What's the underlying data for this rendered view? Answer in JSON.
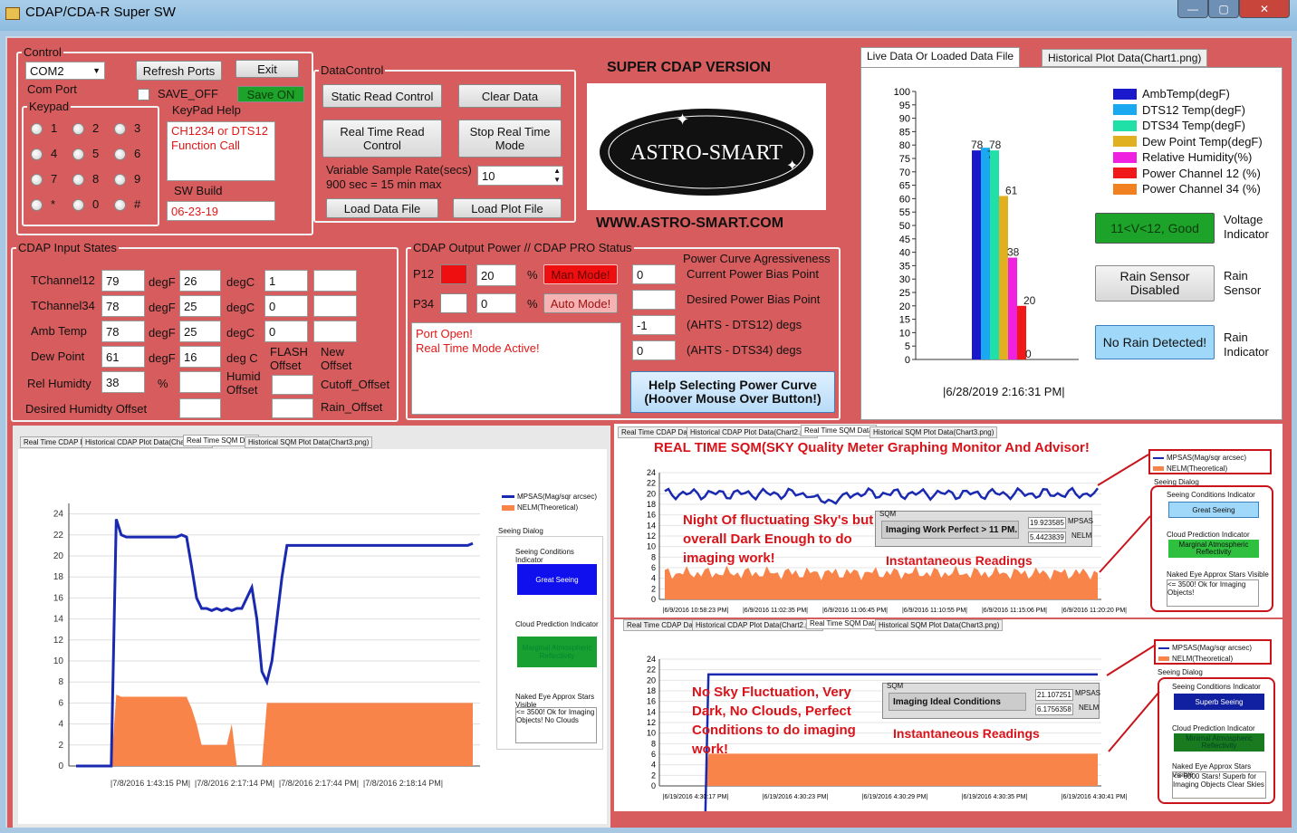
{
  "window": {
    "title": "CDAP/CDA-R Super SW",
    "minimize": "—",
    "maximize": "▢",
    "close": "✕"
  },
  "control": {
    "legend": "Control",
    "com_port_value": "COM2",
    "com_port_label": "Com Port",
    "refresh_ports": "Refresh Ports",
    "exit": "Exit",
    "save_off": "SAVE_OFF",
    "save_on": "Save ON",
    "keypad_legend": "Keypad",
    "keypad_keys": [
      "1",
      "2",
      "3",
      "4",
      "5",
      "6",
      "7",
      "8",
      "9",
      "*",
      "0",
      "#"
    ],
    "keypad_help_label": "KeyPad Help",
    "keypad_help_text": "CH1234 or DTS12 Function Call",
    "sw_build_label": "SW Build",
    "sw_build_value": "06-23-19"
  },
  "data_control": {
    "legend": "DataControl",
    "static_read": "Static Read Control",
    "clear_data": "Clear Data",
    "real_time_read": "Real Time Read Control",
    "stop_real_time": "Stop Real Time Mode",
    "sample_rate_label": "Variable Sample Rate(secs)",
    "sample_rate_hint": "900 sec = 15 min max",
    "sample_rate_value": "10",
    "load_data_file": "Load Data File",
    "load_plot_file": "Load Plot File"
  },
  "logo": {
    "heading": "SUPER CDAP VERSION",
    "brand": "ASTRO-SMART",
    "url": "WWW.ASTRO-SMART.COM"
  },
  "input_states": {
    "legend": "CDAP Input States",
    "rows": [
      {
        "label": "TChannel12",
        "f": "79",
        "f_unit": "degF",
        "c": "26",
        "c_unit": "degC",
        "extra": "1",
        "extra2": ""
      },
      {
        "label": "TChannel34",
        "f": "78",
        "f_unit": "degF",
        "c": "25",
        "c_unit": "degC",
        "extra": "0",
        "extra2": ""
      },
      {
        "label": "Amb Temp",
        "f": "78",
        "f_unit": "degF",
        "c": "25",
        "c_unit": "degC",
        "extra": "0",
        "extra2": ""
      },
      {
        "label": "Dew Point",
        "f": "61",
        "f_unit": "degF",
        "c": "16",
        "c_unit": "deg C"
      }
    ],
    "flash_offset": "FLASH Offset",
    "new_offset": "New Offset",
    "rel_humidity_label": "Rel Humidty",
    "rel_humidity_value": "38",
    "pct": "%",
    "humid_offset": "Humid Offset",
    "cutoff_offset": "Cutoff_Offset",
    "desired_humidity_offset": "Desired Humidty Offset",
    "rain_offset": "Rain_Offset"
  },
  "output_power": {
    "legend": "CDAP Output Power  //  CDAP PRO Status",
    "p12_label": "P12",
    "p12_value": "20",
    "p34_label": "P34",
    "p34_value": "0",
    "pct": "%",
    "man_mode": "Man Mode!",
    "auto_mode": "Auto Mode!",
    "status_lines": [
      "Port Open!",
      "Real Time Mode Active!"
    ],
    "power_curve_title": "Power Curve Agressiveness",
    "rows": [
      {
        "value": "0",
        "label": "Current Power Bias Point"
      },
      {
        "value": "",
        "label": "Desired Power Bias Point"
      },
      {
        "value": "-1",
        "label": "(AHTS - DTS12) degs"
      },
      {
        "value": "0",
        "label": "(AHTS - DTS34) degs"
      }
    ],
    "help_button": "Help Selecting Power Curve (Hoover Mouse Over Button!)"
  },
  "live_chart": {
    "tab_active": "Live Data Or Loaded Data File",
    "tab_inactive": "Historical Plot Data(Chart1.png)",
    "timestamp": "|6/28/2019 2:16:31 PM|",
    "voltage_value": "11<V<12, Good",
    "voltage_label": "Voltage Indicator",
    "rain_sensor_value": "Rain Sensor Disabled",
    "rain_sensor_label": "Rain Sensor",
    "rain_indicator_value": "No Rain Detected!",
    "rain_indicator_label": "Rain Indicator"
  },
  "chart_data": [
    {
      "type": "bar",
      "title": "",
      "ylim": [
        0,
        100
      ],
      "yticks": [
        0,
        5,
        10,
        15,
        20,
        25,
        30,
        35,
        40,
        45,
        50,
        55,
        60,
        65,
        70,
        75,
        80,
        85,
        90,
        95,
        100
      ],
      "series": [
        {
          "name": "AmbTemp(degF)",
          "value": 78,
          "label": "78",
          "color": "#1a1acc"
        },
        {
          "name": "DTS12 Temp(degF)",
          "value": 79,
          "label": "79",
          "color": "#1aa8f0"
        },
        {
          "name": "DTS34 Temp(degF)",
          "value": 78,
          "label": "78",
          "color": "#20e0a8"
        },
        {
          "name": "Dew Point Temp(degF)",
          "value": 61,
          "label": "61",
          "color": "#e0b020"
        },
        {
          "name": "Relative Humidity(%)",
          "value": 38,
          "label": "38",
          "color": "#f020e0"
        },
        {
          "name": "Power Channel 12 (%)",
          "value": 20,
          "label": "20",
          "color": "#f01818"
        },
        {
          "name": "Power Channel 34 (%)",
          "value": 0,
          "label": "0",
          "color": "#f08020"
        }
      ]
    },
    {
      "type": "area",
      "yticks": [
        0,
        2,
        4,
        6,
        8,
        10,
        12,
        14,
        16,
        18,
        20,
        22,
        24
      ],
      "ylim": [
        0,
        25
      ],
      "xticks": [
        "|7/8/2016 1:43:15 PM|",
        "|7/8/2016 2:17:14 PM|",
        "|7/8/2016 2:17:44 PM|",
        "|7/8/2016 2:18:14 PM|"
      ],
      "series": [
        {
          "name": "MPSAS(Mag/sqr arcsec)",
          "type": "line",
          "color": "#1a2ab0",
          "values": [
            0,
            0,
            0,
            0,
            0,
            0,
            0,
            0,
            23.5,
            22,
            21.8,
            21.8,
            21.8,
            21.8,
            21.8,
            21.8,
            21.8,
            21.8,
            21.8,
            21.8,
            21.8,
            22,
            21.8,
            19,
            16,
            15,
            15,
            14.8,
            15,
            14.8,
            15,
            14.8,
            15,
            15,
            16,
            17,
            14,
            9,
            8,
            10,
            14,
            18,
            21,
            21,
            21,
            21,
            21,
            21,
            21,
            21,
            21,
            21,
            21,
            21,
            21,
            21,
            21,
            21,
            21,
            21,
            21,
            21,
            21,
            21,
            21,
            21,
            21,
            21,
            21,
            21,
            21,
            21,
            21,
            21,
            21,
            21,
            21,
            21,
            21,
            21.2
          ]
        },
        {
          "name": "NELM(Theoretical)",
          "type": "area",
          "color": "#f8844a",
          "values": [
            0,
            0,
            0,
            0,
            0,
            0,
            0,
            0,
            6.8,
            6.6,
            6.6,
            6.6,
            6.6,
            6.6,
            6.6,
            6.6,
            6.6,
            6.6,
            6.6,
            6.6,
            6.6,
            6.6,
            6.6,
            5.5,
            4,
            2,
            2,
            2,
            2,
            2,
            2,
            4,
            0,
            0,
            0,
            0,
            0,
            0,
            6,
            6,
            6,
            6,
            6,
            6,
            6,
            6,
            6,
            6,
            6,
            6,
            6,
            6,
            6,
            6,
            6,
            6,
            6,
            6,
            6,
            6,
            6,
            6,
            6,
            6,
            6,
            6,
            6,
            6,
            6,
            6,
            6,
            6,
            6,
            6,
            6,
            6,
            6,
            6,
            6,
            6
          ]
        }
      ]
    }
  ],
  "sqm_main": {
    "tabs": [
      "Real Time CDAP Data",
      "Historical CDAP Plot Data(Chart2.png)",
      "Real Time SQM Data",
      "Historical SQM Plot Data(Chart3.png)"
    ],
    "legend_mpsas": "MPSAS(Mag/sqr arcsec)",
    "legend_nelm": "NELM(Theoretical)",
    "seeing_dialog": "Seeing Dialog",
    "seeing_conditions": "Seeing Conditions Indicator",
    "great_seeing": "Great Seeing",
    "cloud_prediction": "Cloud Prediction Indicator",
    "marginal": "Marginal Atmospheric Reflectivity",
    "naked_eye": "Naked Eye Approx Stars Visible",
    "naked_eye_text": "<= 3500! Ok for Imaging Objects! No Clouds"
  },
  "sqm_top": {
    "heading": "REAL TIME SQM(SKY Quality Meter Graphing Monitor And Advisor!",
    "annotation": "Night Of fluctuating Sky's but overall Dark Enough to do imaging work!",
    "inst": "Instantaneous Readings",
    "sqm_label": "SQM",
    "status": "Imaging Work Perfect > 11 PM.",
    "mpsas_value": "19.923585",
    "mpsas_unit": "MPSAS",
    "nelm_value": "5.4423839",
    "nelm_unit": "NELM",
    "yticks": [
      0,
      2,
      4,
      6,
      8,
      10,
      12,
      14,
      16,
      18,
      20,
      22,
      24
    ],
    "xticks": [
      "|6/9/2016 10:58:23 PM|",
      "|6/9/2016 11:02:35 PM|",
      "|6/9/2016 11:06:45 PM|",
      "|6/9/2016 11:10:55 PM|",
      "|6/9/2016 11:15:06 PM|",
      "|6/9/2016 11:20:20 PM|"
    ],
    "legend_mpsas": "MPSAS(Mag/sqr arcsec)",
    "legend_nelm": "NELM(Theoretical)",
    "seeing_dialog": "Seeing Dialog",
    "seeing_conditions": "Seeing Conditions Indicator",
    "seeing_value": "Great Seeing",
    "cloud_prediction": "Cloud Prediction Indicator",
    "cloud_value": "Marginal Atmospheric Reflectivity",
    "naked_eye": "Naked Eye Approx Stars Visible",
    "naked_eye_text": "<= 3500! Ok for Imaging Objects!"
  },
  "sqm_bottom": {
    "tabs": [
      "Real Time CDAP Data",
      "Historical CDAP Plot Data(Chart2.png)",
      "Real Time SQM Data",
      "Historical SQM Plot Data(Chart3.png)"
    ],
    "annotation": "No Sky Fluctuation, Very Dark, No Clouds, Perfect Conditions to do imaging work!",
    "inst": "Instantaneous Readings",
    "sqm_label": "SQM",
    "status": "Imaging Ideal Conditions",
    "mpsas_value": "21.107251",
    "mpsas_unit": "MPSAS",
    "nelm_value": "6.1756358",
    "nelm_unit": "NELM",
    "yticks": [
      0,
      2,
      4,
      6,
      8,
      10,
      12,
      14,
      16,
      18,
      20,
      22,
      24
    ],
    "xticks": [
      "|6/19/2016 4:30:17 PM|",
      "|6/19/2016 4:30:23 PM|",
      "|6/19/2016 4:30:29 PM|",
      "|6/19/2016 4:30:35 PM|",
      "|6/19/2016 4:30:41 PM|"
    ],
    "legend_mpsas": "MPSAS(Mag/sqr arcsec)",
    "legend_nelm": "NELM(Theoretical)",
    "seeing_dialog": "Seeing Dialog",
    "seeing_conditions": "Seeing Conditions Indicator",
    "seeing_value": "Superb Seeing",
    "cloud_prediction": "Cloud Prediction Indicator",
    "cloud_value": "Minimal Atmospheric Reflectivity",
    "naked_eye": "Naked Eye Approx Stars Visible",
    "naked_eye_text": "<= 6000 Stars! Superb for Imaging Objects Clear Skies"
  }
}
